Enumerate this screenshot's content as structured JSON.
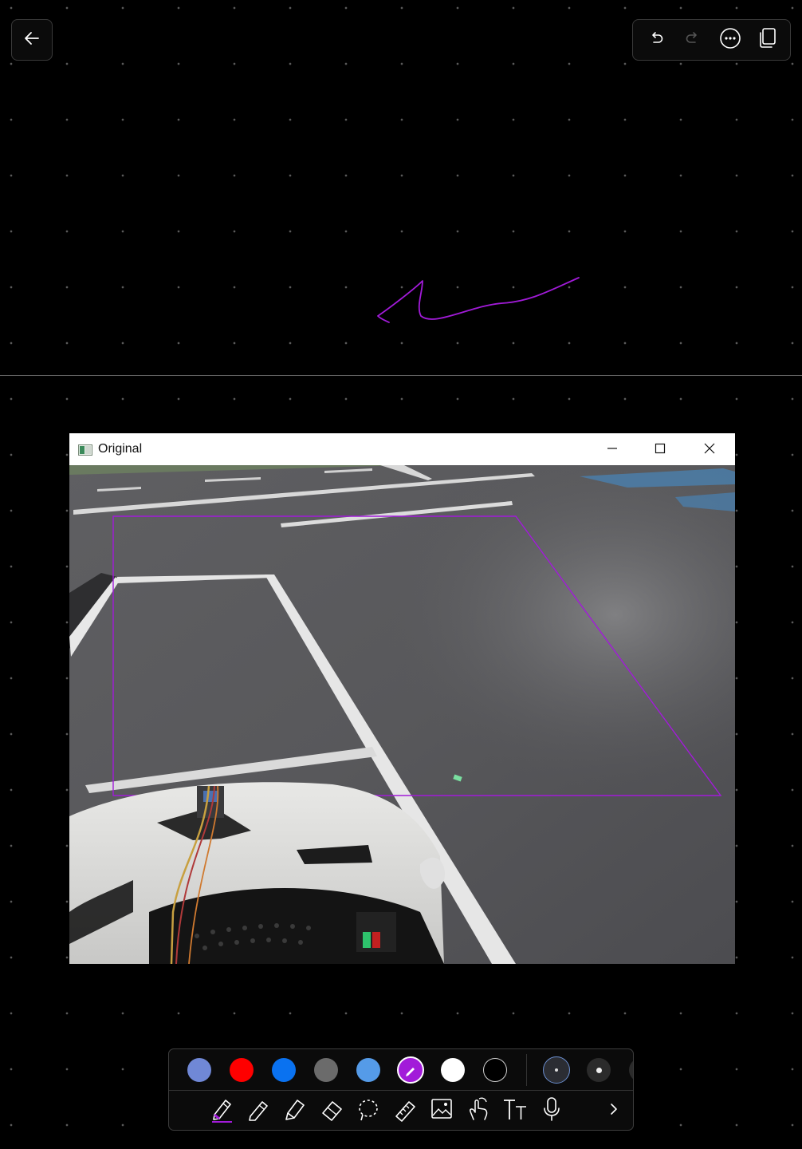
{
  "top_toolbar": {
    "icons": [
      "back-arrow-icon",
      "undo-icon",
      "redo-icon",
      "more-icon",
      "pages-icon"
    ]
  },
  "image_window": {
    "title": "Original",
    "controls": [
      "minimize-icon",
      "maximize-icon",
      "close-icon"
    ]
  },
  "palette": {
    "colors": [
      "#7088d6",
      "#ff0000",
      "#0a72f0",
      "#6b6b6b",
      "#559be8",
      "#a21bd9",
      "#ffffff",
      "#000000"
    ],
    "selected_color": "#a21bd9",
    "pen_sizes": [
      "small",
      "medium"
    ]
  },
  "tools": [
    "pen-icon",
    "pencil-icon",
    "highlighter-icon",
    "eraser-icon",
    "lasso-icon",
    "ruler-icon",
    "image-icon",
    "touch-icon",
    "text-icon",
    "microphone-icon",
    "chevron-right-icon"
  ],
  "ink_color": "#a21bd9"
}
